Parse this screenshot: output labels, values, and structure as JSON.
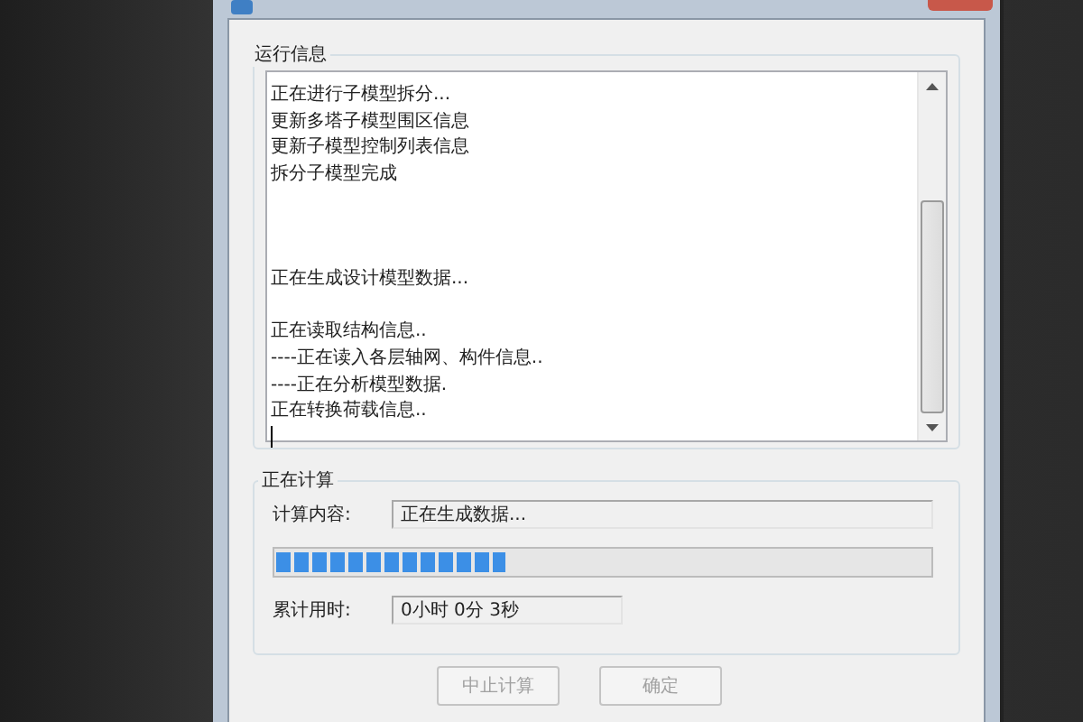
{
  "log_group": {
    "title": "运行信息",
    "lines": [
      {
        "kind": "text",
        "text": "正在进行子模型拆分..."
      },
      {
        "kind": "text",
        "text": "更新多塔子模型围区信息"
      },
      {
        "kind": "text",
        "text": "更新子模型控制列表信息"
      },
      {
        "kind": "text",
        "text": "拆分子模型完成"
      },
      {
        "kind": "blank"
      },
      {
        "kind": "blank"
      },
      {
        "kind": "blank"
      },
      {
        "kind": "text",
        "text": "正在生成设计模型数据..."
      },
      {
        "kind": "blank"
      },
      {
        "kind": "text",
        "text": "正在读取结构信息.."
      },
      {
        "kind": "text",
        "text": "----正在读入各层轴网、构件信息.."
      },
      {
        "kind": "text",
        "text": "----正在分析模型数据."
      },
      {
        "kind": "text",
        "text": "正在转换荷载信息.."
      }
    ]
  },
  "calc_group": {
    "title": "正在计算",
    "content_label": "计算内容:",
    "content_value": "正在生成数据...",
    "progress": {
      "level": 0.35
    },
    "time_label": "累计用时:",
    "time_value": "0小时 0分 3秒"
  },
  "buttons": [
    {
      "label": "中止计算",
      "disabled": true
    },
    {
      "label": "确定",
      "disabled": true
    }
  ]
}
